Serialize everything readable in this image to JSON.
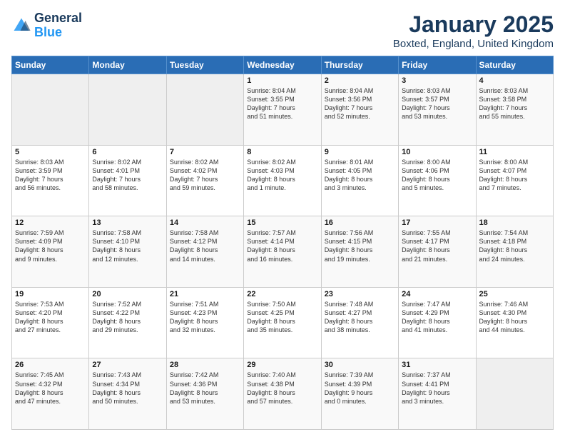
{
  "logo": {
    "line1": "General",
    "line2": "Blue"
  },
  "title": "January 2025",
  "subtitle": "Boxted, England, United Kingdom",
  "days_of_week": [
    "Sunday",
    "Monday",
    "Tuesday",
    "Wednesday",
    "Thursday",
    "Friday",
    "Saturday"
  ],
  "weeks": [
    [
      {
        "day": "",
        "info": ""
      },
      {
        "day": "",
        "info": ""
      },
      {
        "day": "",
        "info": ""
      },
      {
        "day": "1",
        "info": "Sunrise: 8:04 AM\nSunset: 3:55 PM\nDaylight: 7 hours\nand 51 minutes."
      },
      {
        "day": "2",
        "info": "Sunrise: 8:04 AM\nSunset: 3:56 PM\nDaylight: 7 hours\nand 52 minutes."
      },
      {
        "day": "3",
        "info": "Sunrise: 8:03 AM\nSunset: 3:57 PM\nDaylight: 7 hours\nand 53 minutes."
      },
      {
        "day": "4",
        "info": "Sunrise: 8:03 AM\nSunset: 3:58 PM\nDaylight: 7 hours\nand 55 minutes."
      }
    ],
    [
      {
        "day": "5",
        "info": "Sunrise: 8:03 AM\nSunset: 3:59 PM\nDaylight: 7 hours\nand 56 minutes."
      },
      {
        "day": "6",
        "info": "Sunrise: 8:02 AM\nSunset: 4:01 PM\nDaylight: 7 hours\nand 58 minutes."
      },
      {
        "day": "7",
        "info": "Sunrise: 8:02 AM\nSunset: 4:02 PM\nDaylight: 7 hours\nand 59 minutes."
      },
      {
        "day": "8",
        "info": "Sunrise: 8:02 AM\nSunset: 4:03 PM\nDaylight: 8 hours\nand 1 minute."
      },
      {
        "day": "9",
        "info": "Sunrise: 8:01 AM\nSunset: 4:05 PM\nDaylight: 8 hours\nand 3 minutes."
      },
      {
        "day": "10",
        "info": "Sunrise: 8:00 AM\nSunset: 4:06 PM\nDaylight: 8 hours\nand 5 minutes."
      },
      {
        "day": "11",
        "info": "Sunrise: 8:00 AM\nSunset: 4:07 PM\nDaylight: 8 hours\nand 7 minutes."
      }
    ],
    [
      {
        "day": "12",
        "info": "Sunrise: 7:59 AM\nSunset: 4:09 PM\nDaylight: 8 hours\nand 9 minutes."
      },
      {
        "day": "13",
        "info": "Sunrise: 7:58 AM\nSunset: 4:10 PM\nDaylight: 8 hours\nand 12 minutes."
      },
      {
        "day": "14",
        "info": "Sunrise: 7:58 AM\nSunset: 4:12 PM\nDaylight: 8 hours\nand 14 minutes."
      },
      {
        "day": "15",
        "info": "Sunrise: 7:57 AM\nSunset: 4:14 PM\nDaylight: 8 hours\nand 16 minutes."
      },
      {
        "day": "16",
        "info": "Sunrise: 7:56 AM\nSunset: 4:15 PM\nDaylight: 8 hours\nand 19 minutes."
      },
      {
        "day": "17",
        "info": "Sunrise: 7:55 AM\nSunset: 4:17 PM\nDaylight: 8 hours\nand 21 minutes."
      },
      {
        "day": "18",
        "info": "Sunrise: 7:54 AM\nSunset: 4:18 PM\nDaylight: 8 hours\nand 24 minutes."
      }
    ],
    [
      {
        "day": "19",
        "info": "Sunrise: 7:53 AM\nSunset: 4:20 PM\nDaylight: 8 hours\nand 27 minutes."
      },
      {
        "day": "20",
        "info": "Sunrise: 7:52 AM\nSunset: 4:22 PM\nDaylight: 8 hours\nand 29 minutes."
      },
      {
        "day": "21",
        "info": "Sunrise: 7:51 AM\nSunset: 4:23 PM\nDaylight: 8 hours\nand 32 minutes."
      },
      {
        "day": "22",
        "info": "Sunrise: 7:50 AM\nSunset: 4:25 PM\nDaylight: 8 hours\nand 35 minutes."
      },
      {
        "day": "23",
        "info": "Sunrise: 7:48 AM\nSunset: 4:27 PM\nDaylight: 8 hours\nand 38 minutes."
      },
      {
        "day": "24",
        "info": "Sunrise: 7:47 AM\nSunset: 4:29 PM\nDaylight: 8 hours\nand 41 minutes."
      },
      {
        "day": "25",
        "info": "Sunrise: 7:46 AM\nSunset: 4:30 PM\nDaylight: 8 hours\nand 44 minutes."
      }
    ],
    [
      {
        "day": "26",
        "info": "Sunrise: 7:45 AM\nSunset: 4:32 PM\nDaylight: 8 hours\nand 47 minutes."
      },
      {
        "day": "27",
        "info": "Sunrise: 7:43 AM\nSunset: 4:34 PM\nDaylight: 8 hours\nand 50 minutes."
      },
      {
        "day": "28",
        "info": "Sunrise: 7:42 AM\nSunset: 4:36 PM\nDaylight: 8 hours\nand 53 minutes."
      },
      {
        "day": "29",
        "info": "Sunrise: 7:40 AM\nSunset: 4:38 PM\nDaylight: 8 hours\nand 57 minutes."
      },
      {
        "day": "30",
        "info": "Sunrise: 7:39 AM\nSunset: 4:39 PM\nDaylight: 9 hours\nand 0 minutes."
      },
      {
        "day": "31",
        "info": "Sunrise: 7:37 AM\nSunset: 4:41 PM\nDaylight: 9 hours\nand 3 minutes."
      },
      {
        "day": "",
        "info": ""
      }
    ]
  ]
}
